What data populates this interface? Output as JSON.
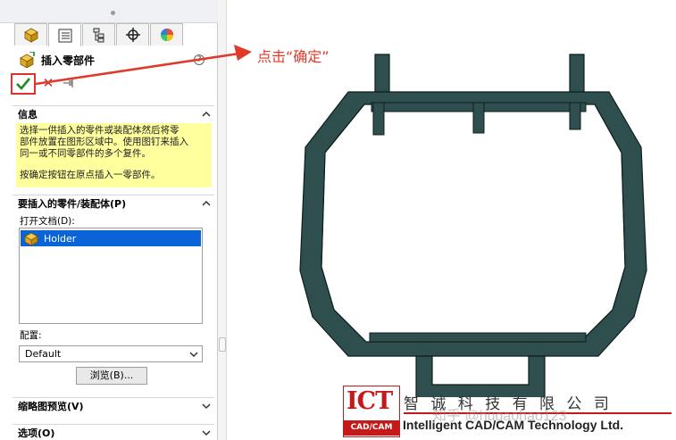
{
  "property_manager": {
    "title": "插入零部件",
    "help": "?",
    "ok": "✔",
    "cancel": "✕",
    "info_section": {
      "label": "信息"
    },
    "info_lines": [
      "选择一供插入的零件或装配体然后将零",
      "部件放置在图形区域中。使用图钉来插入",
      "同一或不同零部件的多个复件。",
      "按确定按钮在原点插入一零部件。"
    ],
    "part_section": {
      "label": "要插入的零件/装配体(P)"
    },
    "open_docs_label": "打开文档(D):",
    "open_docs": [
      "Holder"
    ],
    "config_label": "配置:",
    "config_value": "Default",
    "browse_label": "浏览(B)...",
    "thumbnail_section": {
      "label": "缩略图预览(V)"
    },
    "options_section": {
      "label": "选项(O)"
    }
  },
  "callout": {
    "text": "点击“确定”"
  },
  "logo": {
    "ict": "ICT",
    "cad_cam": "CAD/CAM",
    "company_cn": "智 诚 科 技 有 限 公 司",
    "company_en": "Intelligent CAD/CAM Technology Ltd.",
    "watermark": "知乎 @hugaohao123"
  },
  "colors": {
    "part": "#2e4f4d",
    "callout": "#e03a2a",
    "selection": "#0a64d8",
    "info_bg": "#ffff9e"
  }
}
